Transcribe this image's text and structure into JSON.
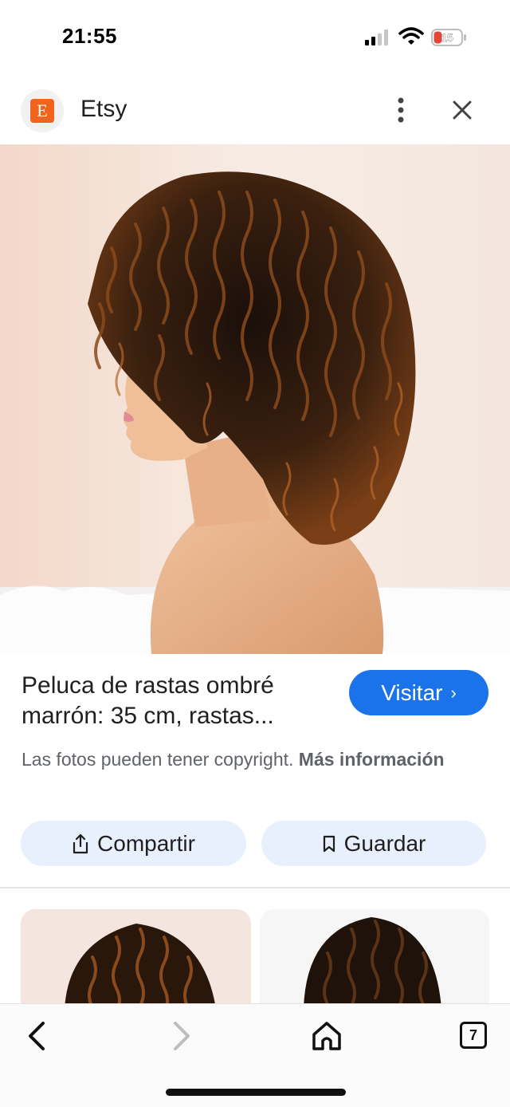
{
  "status_bar": {
    "time": "21:55",
    "battery_level": "15",
    "battery_color": "#e0453a",
    "icons": [
      "signal-icon",
      "wifi-icon",
      "battery-icon"
    ]
  },
  "header": {
    "site_initial": "E",
    "site_name": "Etsy",
    "brand_color": "#f1641e",
    "icons": [
      "more-vert-icon",
      "close-icon"
    ]
  },
  "result": {
    "title": "Peluca de rastas ombré marrón: 35 cm, rastas...",
    "visit_label": "Visitar",
    "copyright_text": "Las fotos pueden tener copyright.",
    "more_info_label": "Más información",
    "share_label": "Compartir",
    "save_label": "Guardar",
    "accent_color": "#1a73e8"
  },
  "toolbar": {
    "tab_count": "7",
    "icons": [
      "back-icon",
      "forward-icon",
      "home-icon",
      "tabs-icon"
    ]
  }
}
